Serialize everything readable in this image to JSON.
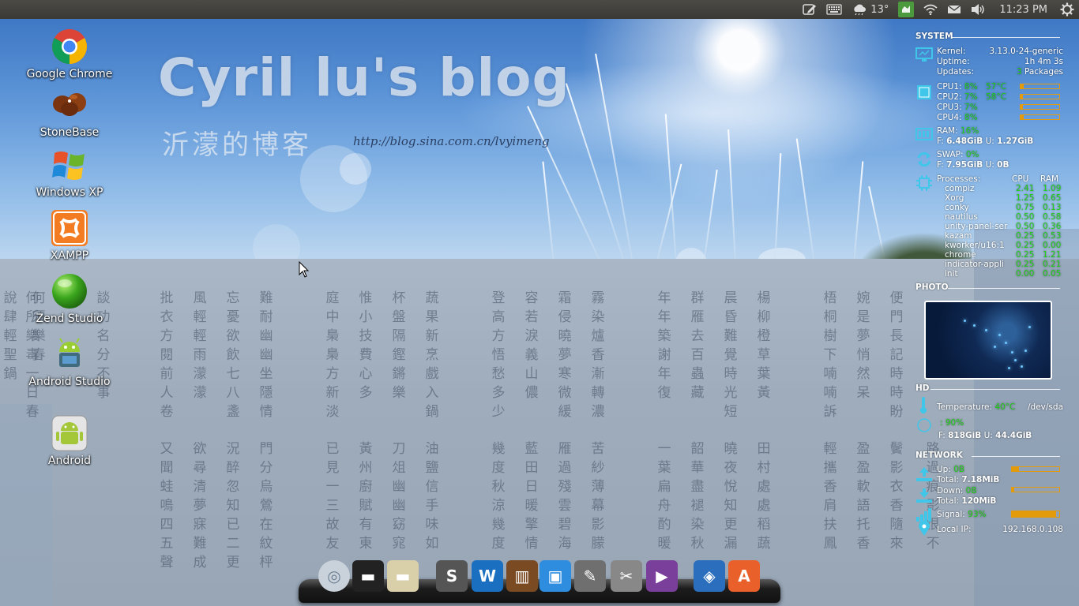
{
  "top_panel": {
    "weather_temp": "13°",
    "clock": "11:23 PM",
    "indicators": [
      "edit-icon",
      "keyboard-icon",
      "weather-icon",
      "app-indicator-icon",
      "wifi-icon",
      "mail-icon",
      "volume-icon",
      "session-gear-icon"
    ]
  },
  "desktop_icons": [
    {
      "label": "Google Chrome",
      "icon": "chrome-icon"
    },
    {
      "label": "StoneBase",
      "icon": "stonebase-icon"
    },
    {
      "label": "Windows XP",
      "icon": "windows-icon"
    },
    {
      "label": "XAMPP",
      "icon": "xampp-icon"
    },
    {
      "label": "Zend Studio",
      "icon": "zend-icon"
    },
    {
      "label": "Android Studio",
      "icon": "android-studio-icon"
    },
    {
      "label": "Android",
      "icon": "android-icon"
    }
  ],
  "wallpaper": {
    "title": "Cyril lu's blog",
    "subtitle": "沂濛的博客",
    "url": "http://blog.sina.com.cn/lvyimeng",
    "poem_columns": [
      "何所樂毒一日春",
      "談功名分不事",
      "批衣方閱前人卷",
      "風輕輕雨濛濛",
      "忘憂欲飲七八盞",
      "難耐幽幽坐隱情",
      "庭中梟梟方新淡",
      "惟小技費心多",
      "杯盤隔鏗鏘樂",
      "蔬果新烹戲入鍋",
      "登高方悟愁多少",
      "容若淚義山儂",
      "霜侵曉夢寒微緩",
      "霧染爐香漸轉濃",
      "年年築謝年復",
      "群雁去百蟲藏",
      "晨昏難覺時光短",
      "楊柳橙草葉黃",
      "梧桐樹下喃喃訴",
      "婉是夢悄然呆",
      "便門長記時時盼",
      "又聞蛙鳴四五聲",
      "欲尋清夢寐難成",
      "況醉忽知已二更",
      "門分烏鶯在紋枰",
      "已見一三故友",
      "黃州廚賦有東",
      "刀俎幽幽窈窕",
      "油鹽信手味如",
      "幾度秋涼幾度",
      "藍田日暖擎情",
      "雁過殘雲碧海",
      "苦紗薄幕影朦",
      "一葉扁舟酌暖",
      "韶華盡褪染秋",
      "曉夜悅知更漏",
      "田村處處稻蔬",
      "輕攜香肩扶鳳",
      "盈盈軟語托香",
      "鬢影衣香隨來",
      "路過痕影恨不"
    ],
    "left_poem": [
      "說肆輕聖鍋",
      "何須樂春"
    ]
  },
  "conky": {
    "system": {
      "header": "SYSTEM",
      "kernel_label": "Kernel:",
      "kernel": "3.13.0-24-generic",
      "uptime_label": "Uptime:",
      "uptime": "1h 4m 3s",
      "updates_label": "Updates:",
      "updates_count": "3",
      "updates_suffix": "Packages",
      "cpus": [
        {
          "label": "CPU1:",
          "usage": "8%",
          "temp": "57°C",
          "fill": 0.08
        },
        {
          "label": "CPU2:",
          "usage": "7%",
          "temp": "58°C",
          "fill": 0.07
        },
        {
          "label": "CPU3:",
          "usage": "7%",
          "temp": "",
          "fill": 0.07
        },
        {
          "label": "CPU4:",
          "usage": "8%",
          "temp": "",
          "fill": 0.08
        }
      ],
      "ram_label": "RAM:",
      "ram_pct": "16%",
      "ram_free_label": "F:",
      "ram_free": "6.48GiB",
      "ram_used_label": "U:",
      "ram_used": "1.27GiB",
      "swap_label": "SWAP:",
      "swap_pct": "0%",
      "swap_free_label": "F:",
      "swap_free": "7.95GiB",
      "swap_used_label": "U:",
      "swap_used": "0B",
      "processes_label": "Processes:",
      "cpu_col": "CPU",
      "ram_col": "RAM",
      "processes": [
        {
          "name": "compiz",
          "cpu": "2.41",
          "ram": "1.09"
        },
        {
          "name": "Xorg",
          "cpu": "1.25",
          "ram": "0.65"
        },
        {
          "name": "conky",
          "cpu": "0.75",
          "ram": "0.13"
        },
        {
          "name": "nautilus",
          "cpu": "0.50",
          "ram": "0.58"
        },
        {
          "name": "unity-panel-ser",
          "cpu": "0.50",
          "ram": "0.36"
        },
        {
          "name": "kazam",
          "cpu": "0.25",
          "ram": "0.53"
        },
        {
          "name": "kworker/u16:1",
          "cpu": "0.25",
          "ram": "0.00"
        },
        {
          "name": "chrome",
          "cpu": "0.25",
          "ram": "1.21"
        },
        {
          "name": "indicator-appli",
          "cpu": "0.25",
          "ram": "0.21"
        },
        {
          "name": "init",
          "cpu": "0.00",
          "ram": "0.05"
        }
      ]
    },
    "photo": {
      "header": "PHOTO"
    },
    "hd": {
      "header": "HD",
      "temp_label": "Temperature:",
      "temp": "40°C",
      "device": "/dev/sda",
      "usage": ": 90%",
      "free_label": "F:",
      "free": "818GiB",
      "used_label": "U:",
      "used": "44.4GiB"
    },
    "network": {
      "header": "NETWORK",
      "up_label": "Up:",
      "up": "0B",
      "up_total_label": "Total:",
      "up_total": "7.18MiB",
      "down_label": "Down:",
      "down": "0B",
      "down_total_label": "Total:",
      "down_total": "120MiB",
      "signal_label": "Signal:",
      "signal": "93%",
      "signal_fill": 0.93,
      "up_fill": 0.15,
      "down_fill": 0.05,
      "ip_label": "Local IP:",
      "ip": "192.168.0.108"
    }
  },
  "dock": {
    "items": [
      "ubuntu-launcher-icon",
      "drive-icon",
      "drive-2-icon",
      "scribus-icon",
      "wps-writer-icon",
      "library-icon",
      "image-viewer-icon",
      "gimp-icon",
      "video-editor-icon",
      "media-player-icon",
      "virtualbox-icon",
      "software-center-icon"
    ]
  },
  "colors": {
    "panel_bg": "#3c3b37",
    "conky_green": "#22d11a",
    "conky_orange": "#e39b0c",
    "conky_cyan": "#3fc6e8"
  }
}
